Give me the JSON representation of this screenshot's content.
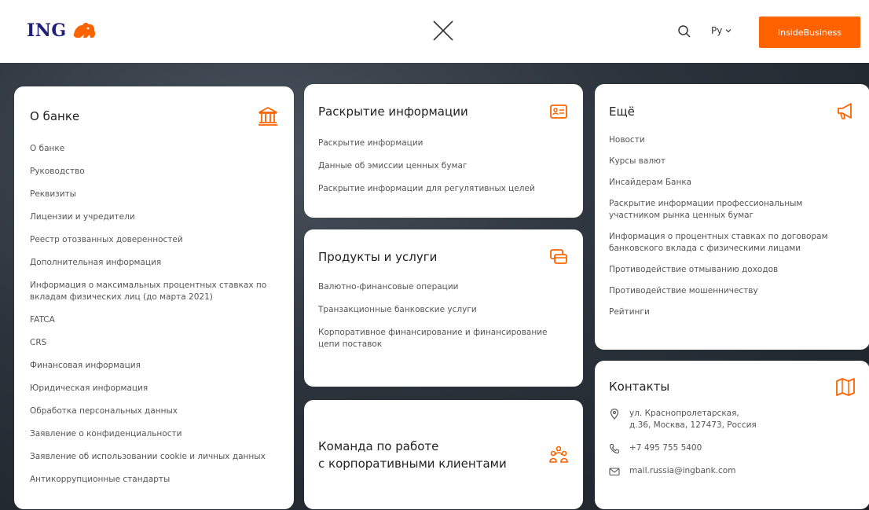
{
  "header": {
    "logo_text": "ING",
    "language": "Ру",
    "cta_label": "InsideBusiness"
  },
  "colors": {
    "accent": "#ff6200",
    "brand_navy": "#1f1f7a"
  },
  "about": {
    "title": "О банке",
    "icon": "bank-building-icon",
    "links": [
      "О банке",
      "Руководство",
      "Реквизиты",
      "Лицензии и учредители",
      "Реестр отозванных доверенностей",
      "Дополнительная информация",
      "Информация о максимальных процентных ставках по вкладам физических лиц (до марта 2021)",
      "FATCA",
      "CRS",
      "Финансовая информация",
      "Юридическая информация",
      "Обработка персональных данных",
      "Заявление о конфиденциальности",
      "Заявление об использовании cookie и личных данных",
      "Антикоррупционные стандарты"
    ]
  },
  "disclosure": {
    "title": "Раскрытие информации",
    "icon": "id-card-icon",
    "links": [
      "Раскрытие информации",
      "Данные об эмиссии ценных бумаг",
      "Раскрытие информации для регулятивных целей"
    ]
  },
  "products": {
    "title": "Продукты и услуги",
    "icon": "cards-icon",
    "links": [
      "Валютно-финансовые операции",
      "Транзакционные банковские услуги",
      "Корпоративное финансирование и финансирование цепи поставок"
    ]
  },
  "team": {
    "title_line1": "Команда по работе",
    "title_line2": "с корпоративными клиентами",
    "icon": "team-icon"
  },
  "more": {
    "title": "Ещё",
    "icon": "megaphone-icon",
    "links": [
      "Новости",
      "Курсы валют",
      "Инсайдерам Банка",
      "Раскрытие информации профессиональным участником рынка ценных бумаг",
      "Информация о процентных ставках по договорам банковского вклада с физическими лицами",
      "Противодействие отмыванию доходов",
      "Противодействие мошенничеству",
      "Рейтинги"
    ]
  },
  "contacts": {
    "title": "Контакты",
    "icon": "map-icon",
    "address_line1": "ул. Краснопролетарская,",
    "address_line2": "д.36, Москва, 127473, Россия",
    "phone": "+7 495 755 5400",
    "email": "mail.russia@ingbank.com"
  }
}
